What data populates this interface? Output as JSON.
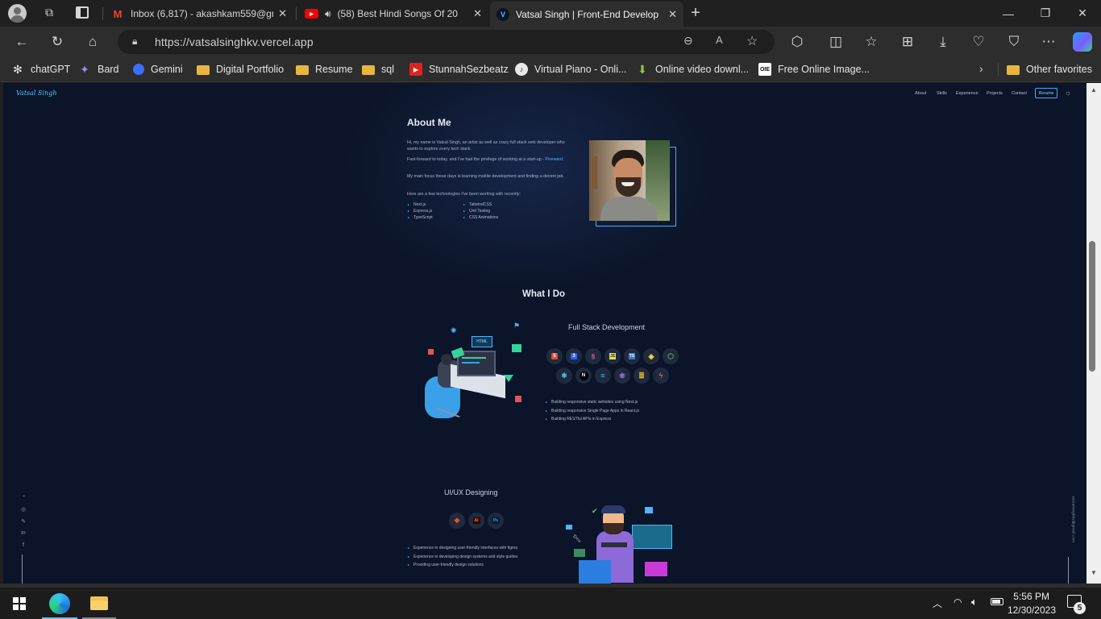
{
  "browser": {
    "tabs": [
      {
        "label": "Inbox (6,817) - akashkam559@gm",
        "icon": "gmail-icon",
        "active": false
      },
      {
        "label": "(58) Best Hindi Songs Of 20",
        "icon": "youtube-icon",
        "active": false,
        "audio": true
      },
      {
        "label": "Vatsal Singh | Front-End Develop",
        "icon": "site-v-icon",
        "active": true
      }
    ],
    "new_tab": "+",
    "url": "https://vatsalsinghkv.vercel.app",
    "favorites": [
      {
        "label": "chatGPT",
        "icon": "chatgpt-icon"
      },
      {
        "label": "Bard",
        "icon": "bard-icon"
      },
      {
        "label": "Gemini",
        "icon": "gemini-icon"
      },
      {
        "label": "Digital Portfolio",
        "icon": "folder-icon"
      },
      {
        "label": "Resume",
        "icon": "folder-icon"
      },
      {
        "label": "sql",
        "icon": "folder-icon"
      },
      {
        "label": "StunnahSezbeatz",
        "icon": "youtube-icon"
      },
      {
        "label": "Virtual Piano - Onli...",
        "icon": "piano-icon"
      },
      {
        "label": "Online video downl...",
        "icon": "download-icon"
      },
      {
        "label": "Free Online Image...",
        "icon": "oie-icon"
      }
    ],
    "other_favorites": "Other favorites"
  },
  "site": {
    "logo": "Vatsal Singh",
    "nav": [
      "About",
      "Skills",
      "Experience",
      "Projects",
      "Contact"
    ],
    "resume_button": "Resume",
    "about": {
      "title": "About Me",
      "paragraphs": [
        "Hi, my name is Vatsal Singh, an artist as well as crazy full stack web developer who wants to explore every tech stack.",
        "Fast-forward to today, and I've had the privilege of working at a start-up -",
        "My main focus these days is learning mobile development and finding a decent job.",
        "Here are a few technologies I've been working with recently:"
      ],
      "company_link": "Pixeward.",
      "tech_col1": [
        "Next.js",
        "Express.js",
        "TypeScript"
      ],
      "tech_col2": [
        "TailwindCSS",
        "Unit Testing",
        "CSS Animations"
      ]
    },
    "what_i_do": {
      "title": "What I Do",
      "fullstack": {
        "title": "Full Stack Development",
        "points": [
          "Building responsive static websites using Next.js",
          "Building responsive Single Page Apps in React.js",
          "Building RESTful APIs in Express"
        ]
      },
      "uiux": {
        "title": "UI/UX Designing",
        "points": [
          "Experience in designing user-friendly interfaces with figma",
          "Experience in developing design systems and style guides",
          "Providing user-friendly design solutions"
        ]
      }
    },
    "side_email": "vatsalsinghkv@gmail.com"
  },
  "taskbar": {
    "time": "5:56 PM",
    "date": "12/30/2023",
    "notifications": "5"
  },
  "colors": {
    "page_bg": "#0b1428",
    "accent": "#4fb5ff"
  }
}
